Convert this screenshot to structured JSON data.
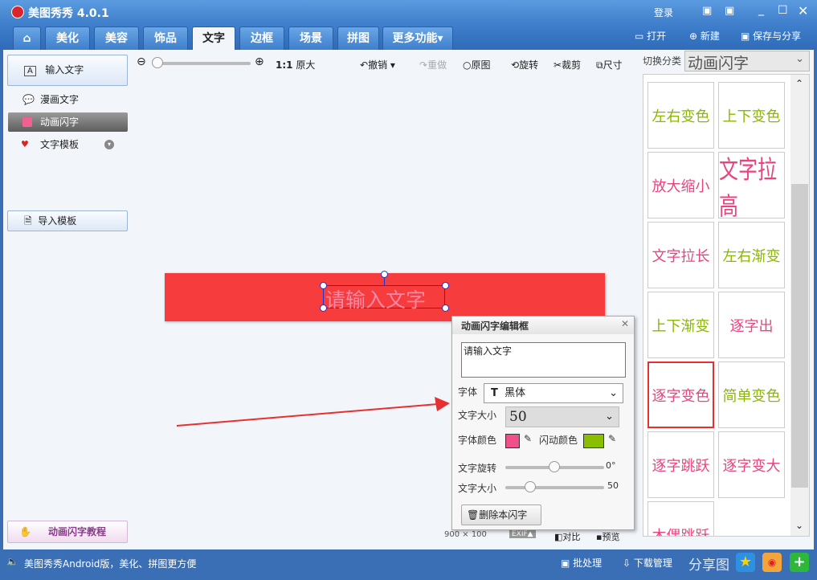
{
  "app": {
    "title": "美图秀秀 4.0.1",
    "login": "登录"
  },
  "tabs": [
    "美化",
    "美容",
    "饰品",
    "文字",
    "边框",
    "场景",
    "拼图",
    "更多功能"
  ],
  "active_tab": "文字",
  "header_actions": {
    "open": "打开",
    "new": "新建",
    "save": "保存与分享"
  },
  "left": {
    "input_text": "输入文字",
    "items": [
      "漫画文字",
      "动画闪字",
      "文字模板"
    ],
    "import": "导入模板",
    "tutorial": "动画闪字教程"
  },
  "toolbar": {
    "ratio": "1:1",
    "original_size": "原大",
    "undo": "撤销",
    "redo": "重做",
    "original": "原图",
    "rotate": "旋转",
    "crop": "裁剪",
    "size": "尺寸"
  },
  "canvas": {
    "text": "请输入文字",
    "dimensions": "900 × 100",
    "exif": "EXIF▲",
    "compare": "对比",
    "preview": "预览"
  },
  "category": {
    "label": "切换分类",
    "selected": "动画闪字"
  },
  "effects": [
    {
      "name": "左右变色",
      "color": "#8ab800"
    },
    {
      "name": "上下变色",
      "color": "#8ab800"
    },
    {
      "name": "放大缩小",
      "color": "#e8457f"
    },
    {
      "name": "文字拉高",
      "color": "#e8457f"
    },
    {
      "name": "文字拉长",
      "color": "#e8457f"
    },
    {
      "name": "左右渐变",
      "color": "#8ab800"
    },
    {
      "name": "上下渐变",
      "color": "#8ab800"
    },
    {
      "name": "逐字出",
      "color": "#e8457f"
    },
    {
      "name": "逐字变色",
      "color": "#e8457f"
    },
    {
      "name": "简单变色",
      "color": "#8ab800"
    },
    {
      "name": "逐字跳跃",
      "color": "#e8457f"
    },
    {
      "name": "逐字变大",
      "color": "#e8457f"
    },
    {
      "name": "木偶跳跃",
      "color": "#e8457f"
    }
  ],
  "dialog": {
    "title": "动画闪字编辑框",
    "text": "请输入文字",
    "font_label": "字体",
    "font": "黑体",
    "size_label": "文字大小",
    "size": "50",
    "font_color_label": "字体颜色",
    "font_color": "#f0508a",
    "flash_color_label": "闪动颜色",
    "flash_color": "#8abf00",
    "rotate_label": "文字旋转",
    "rotate_value": "0°",
    "size2_label": "文字大小",
    "size2_value": "50",
    "delete": "删除本闪字"
  },
  "status": {
    "promo": "美图秀秀Android版，美化、拼图更方便",
    "batch": "批处理",
    "download": "下载管理",
    "share": "分享图"
  }
}
